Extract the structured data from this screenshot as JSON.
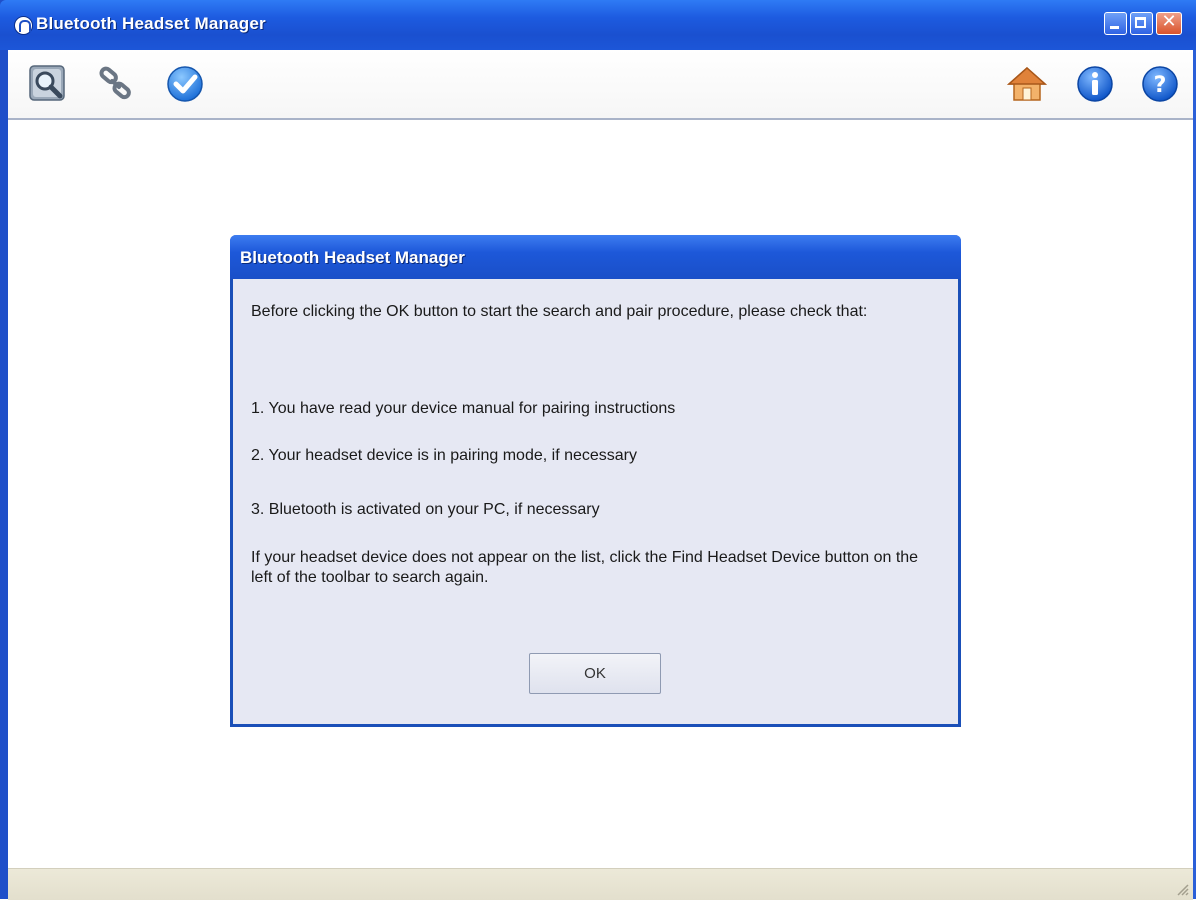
{
  "window": {
    "title": "Bluetooth Headset Manager"
  },
  "toolbar": {
    "left_icons": [
      "find-headset-icon",
      "link-icon",
      "checkmark-icon"
    ],
    "right_icons": [
      "home-icon",
      "info-icon",
      "help-icon"
    ]
  },
  "dialog": {
    "title": "Bluetooth Headset Manager",
    "intro": "Before clicking the OK button to start the search and pair procedure, please check that:",
    "items": [
      "1. You have read your device manual for pairing instructions",
      "2. Your headset device is in pairing mode, if necessary",
      "3. Bluetooth is activated on your PC, if necessary"
    ],
    "outro": "If your headset device does not appear on the list, click the Find Headset Device button on the left of the toolbar to search again.",
    "ok_label": "OK"
  },
  "colors": {
    "titlebar_blue": "#1d5be0",
    "dialog_background": "#e6e8f3",
    "dialog_border": "#1a4fb8"
  }
}
